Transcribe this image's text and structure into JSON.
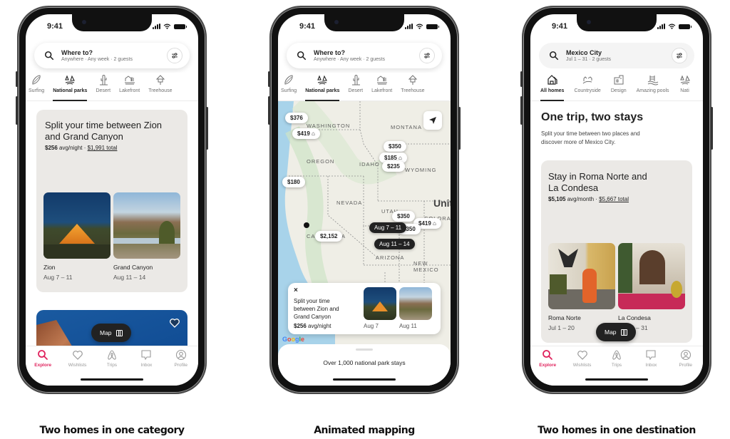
{
  "status_time": "9:41",
  "brand_color": "#E0245E",
  "phones": [
    {
      "search": {
        "title": "Where to?",
        "subtitle": "Anywhere · Any week · 2 guests"
      },
      "categories": [
        {
          "label": "Surfing",
          "icon": "surfboard-icon",
          "active": false
        },
        {
          "label": "National parks",
          "icon": "national-park-icon",
          "active": true
        },
        {
          "label": "Desert",
          "icon": "cactus-icon",
          "active": false
        },
        {
          "label": "Lakefront",
          "icon": "lakefront-icon",
          "active": false
        },
        {
          "label": "Treehouse",
          "icon": "treehouse-icon",
          "active": false
        }
      ],
      "card": {
        "title": "Split your time between Zion and Grand Canyon",
        "price_bold": "$256",
        "price_rest": "avg/night",
        "total": "$1,991 total",
        "stays": [
          {
            "name": "Zion",
            "dates": "Aug 7 – 11"
          },
          {
            "name": "Grand Canyon",
            "dates": "Aug 11 – 14"
          }
        ]
      },
      "map_button": "Map"
    },
    {
      "search": {
        "title": "Where to?",
        "subtitle": "Anywhere · Any week · 2 guests"
      },
      "categories": [
        {
          "label": "Surfing",
          "icon": "surfboard-icon",
          "active": false
        },
        {
          "label": "National parks",
          "icon": "national-park-icon",
          "active": true
        },
        {
          "label": "Desert",
          "icon": "cactus-icon",
          "active": false
        },
        {
          "label": "Lakefront",
          "icon": "lakefront-icon",
          "active": false
        },
        {
          "label": "Treehouse",
          "icon": "treehouse-icon",
          "active": false
        }
      ],
      "map": {
        "states": [
          "WASHINGTON",
          "MONTANA",
          "OREGON",
          "IDAHO",
          "WYOMING",
          "NEVADA",
          "UTAH",
          "COLORADO",
          "CALIFORNIA",
          "ARIZONA",
          "NEW MEXICO",
          "United"
        ],
        "pins": [
          "$376",
          "$419",
          "$350",
          "$185",
          "$235",
          "$180",
          "$350",
          "$419",
          "$350",
          "$2,152"
        ],
        "date_pins": [
          "Aug 7 – 11",
          "Aug 11 – 14"
        ],
        "attribution": "Google"
      },
      "map_card": {
        "title": "Split your time between Zion and Grand Canyon",
        "price_bold": "$256",
        "price_rest": "avg/night",
        "stays": [
          {
            "dates": "Aug 7"
          },
          {
            "dates": "Aug 11"
          }
        ]
      },
      "sheet_text": "Over 1,000 national park stays"
    },
    {
      "search": {
        "title": "Mexico City",
        "subtitle": "Jul 1 – 31 · 2 guests"
      },
      "categories": [
        {
          "label": "All homes",
          "icon": "house-icon",
          "active": true
        },
        {
          "label": "Countryside",
          "icon": "countryside-icon",
          "active": false
        },
        {
          "label": "Design",
          "icon": "design-icon",
          "active": false
        },
        {
          "label": "Amazing pools",
          "icon": "pool-icon",
          "active": false
        },
        {
          "label": "Nati",
          "icon": "national-park-icon",
          "active": false
        }
      ],
      "heading": "One trip, two stays",
      "subheading": "Split your time between two places and discover more of Mexico City.",
      "card": {
        "title": "Stay in Roma Norte and La Condesa",
        "price_bold": "$5,105",
        "price_rest": "avg/month",
        "total": "$5,667 total",
        "stays": [
          {
            "name": "Roma Norte",
            "dates": "Jul 1 – 20"
          },
          {
            "name": "La Condesa",
            "dates": "Jul 20 – 31"
          }
        ]
      },
      "map_button": "Map"
    }
  ],
  "tabs": [
    {
      "label": "Explore",
      "icon": "search-icon",
      "active": true
    },
    {
      "label": "Wishlists",
      "icon": "heart-icon",
      "active": false
    },
    {
      "label": "Trips",
      "icon": "airbnb-logo-icon",
      "active": false
    },
    {
      "label": "Inbox",
      "icon": "message-icon",
      "active": false
    },
    {
      "label": "Profile",
      "icon": "profile-icon",
      "active": false
    }
  ],
  "captions": [
    "Two homes in one category",
    "Animated mapping",
    "Two homes in one destination"
  ]
}
